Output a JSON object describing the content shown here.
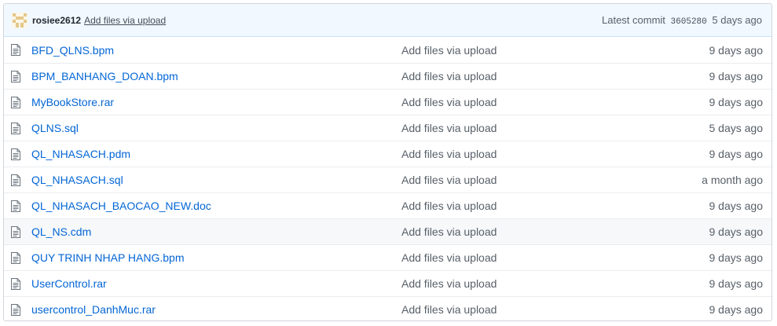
{
  "commit": {
    "author": "rosiee2612",
    "message": "Add files via upload",
    "latest_label": "Latest commit",
    "sha": "3605280",
    "age": "5 days ago"
  },
  "files": [
    {
      "name": "BFD_QLNS.bpm",
      "message": "Add files via upload",
      "age": "9 days ago"
    },
    {
      "name": "BPM_BANHANG_DOAN.bpm",
      "message": "Add files via upload",
      "age": "9 days ago"
    },
    {
      "name": "MyBookStore.rar",
      "message": "Add files via upload",
      "age": "9 days ago"
    },
    {
      "name": "QLNS.sql",
      "message": "Add files via upload",
      "age": "5 days ago"
    },
    {
      "name": "QL_NHASACH.pdm",
      "message": "Add files via upload",
      "age": "9 days ago"
    },
    {
      "name": "QL_NHASACH.sql",
      "message": "Add files via upload",
      "age": "a month ago"
    },
    {
      "name": "QL_NHASACH_BAOCAO_NEW.doc",
      "message": "Add files via upload",
      "age": "9 days ago"
    },
    {
      "name": "QL_NS.cdm",
      "message": "Add files via upload",
      "age": "9 days ago"
    },
    {
      "name": "QUY TRINH NHAP HANG.bpm",
      "message": "Add files via upload",
      "age": "9 days ago"
    },
    {
      "name": "UserControl.rar",
      "message": "Add files via upload",
      "age": "9 days ago"
    },
    {
      "name": "usercontrol_DanhMuc.rar",
      "message": "Add files via upload",
      "age": "9 days ago"
    }
  ],
  "icons": {
    "avatar": "identicon-avatar",
    "file": "file-icon"
  },
  "colors": {
    "link": "#0366d6",
    "commit_bar_bg": "#f1f8ff",
    "hover_row_bg": "#f6f8fa"
  }
}
